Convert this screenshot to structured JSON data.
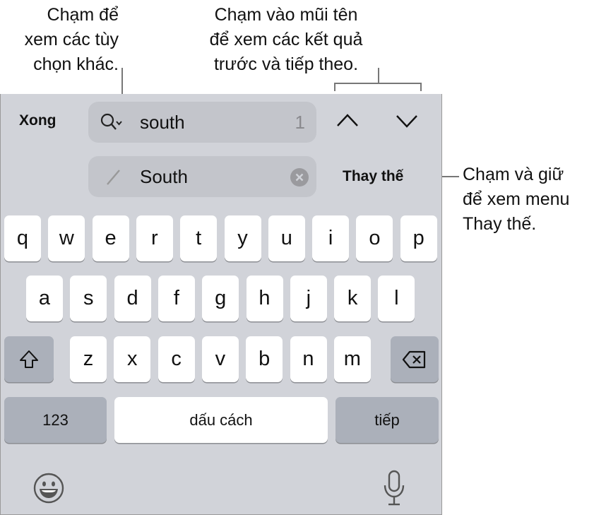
{
  "callouts": {
    "options": [
      "Chạm để",
      "xem các tùy",
      "chọn khác."
    ],
    "arrows": [
      "Chạm vào mũi tên",
      "để xem các kết quả",
      "trước và tiếp theo."
    ],
    "replace_menu": [
      "Chạm và giữ",
      "để xem menu",
      "Thay thế."
    ]
  },
  "find_bar": {
    "done_label": "Xong",
    "search_value": "south",
    "match_count": "1",
    "replace_value": "South",
    "replace_label": "Thay thế"
  },
  "keyboard": {
    "row1": [
      "q",
      "w",
      "e",
      "r",
      "t",
      "y",
      "u",
      "i",
      "o",
      "p"
    ],
    "row2": [
      "a",
      "s",
      "d",
      "f",
      "g",
      "h",
      "j",
      "k",
      "l"
    ],
    "row3": [
      "z",
      "x",
      "c",
      "v",
      "b",
      "n",
      "m"
    ],
    "numbers_label": "123",
    "space_label": "dấu cách",
    "next_label": "tiếp"
  }
}
